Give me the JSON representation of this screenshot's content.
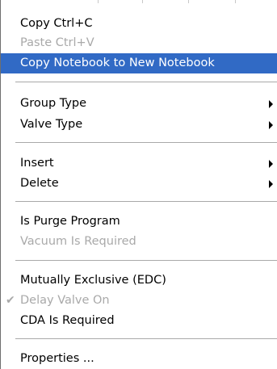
{
  "menu": {
    "items": [
      {
        "label": "Copy  Ctrl+C",
        "enabled": true
      },
      {
        "label": "Paste Ctrl+V",
        "enabled": false
      },
      {
        "label": "Copy Notebook to New Notebook",
        "enabled": true,
        "selected": true
      },
      {
        "label": "Group Type",
        "enabled": true,
        "submenu": true
      },
      {
        "label": "Valve Type",
        "enabled": true,
        "submenu": true
      },
      {
        "label": "Insert",
        "enabled": true,
        "submenu": true
      },
      {
        "label": "Delete",
        "enabled": true,
        "submenu": true
      },
      {
        "label": "Is Purge Program",
        "enabled": true
      },
      {
        "label": "Vacuum Is Required",
        "enabled": false
      },
      {
        "label": "Mutually Exclusive (EDC)",
        "enabled": true
      },
      {
        "label": "Delay Valve On",
        "enabled": false,
        "checked": true
      },
      {
        "label": "CDA Is Required",
        "enabled": true
      },
      {
        "label": "Properties ...",
        "enabled": true
      }
    ],
    "check_glyph": "✔",
    "colors": {
      "highlight": "#316ac5",
      "highlight_text": "#ffffff",
      "text": "#000000",
      "disabled_text": "#a9a9a9"
    }
  }
}
